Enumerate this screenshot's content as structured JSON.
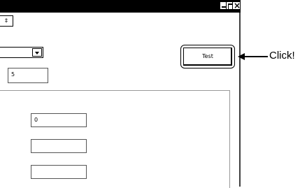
{
  "window": {
    "caption_buttons": {
      "minimize_icon": "minimize-icon",
      "maximize_icon": "maximize-icon",
      "close_icon": "close-icon",
      "close_glyph": "×"
    },
    "tab_stub_text": "‡"
  },
  "form": {
    "combo": {
      "selected": ""
    },
    "textbox_top": {
      "value": "5"
    },
    "group": {
      "fields": [
        {
          "value": "0"
        },
        {
          "value": ""
        },
        {
          "value": ""
        }
      ]
    },
    "test_button_label": "Test"
  },
  "callout": {
    "label": "Click!"
  }
}
